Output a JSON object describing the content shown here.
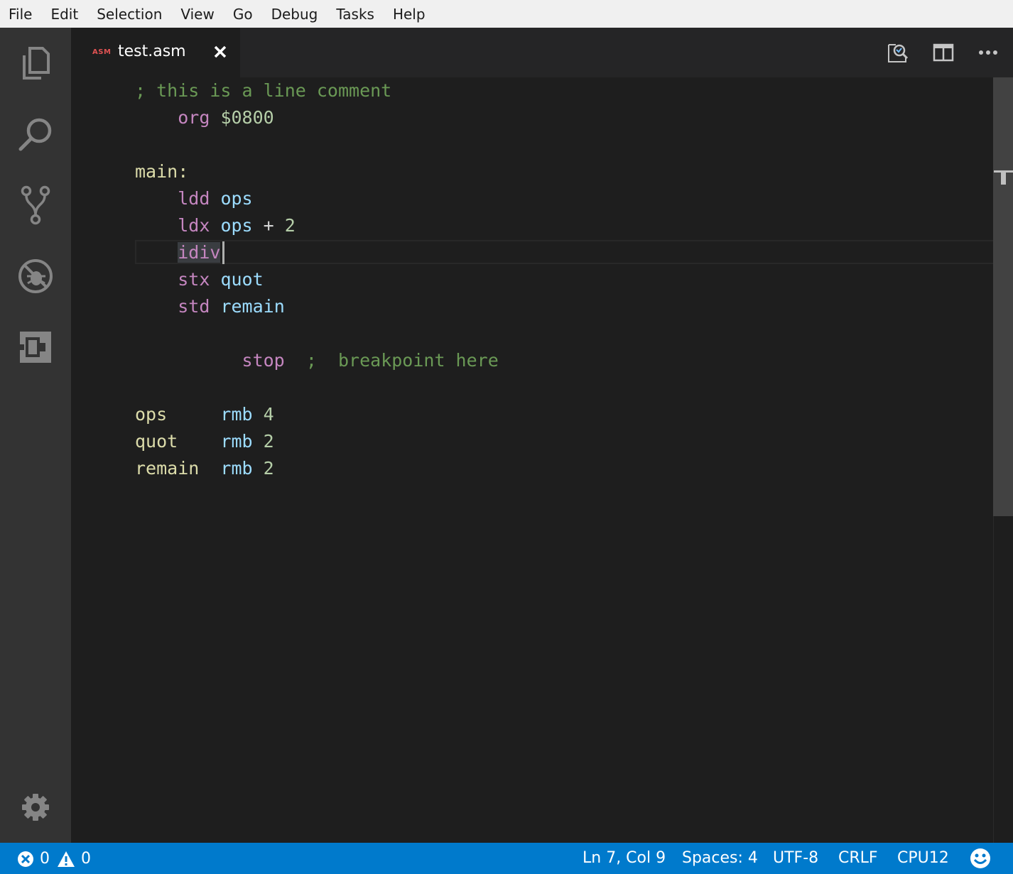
{
  "menu": [
    "File",
    "Edit",
    "Selection",
    "View",
    "Go",
    "Debug",
    "Tasks",
    "Help"
  ],
  "activity_bar": [
    {
      "icon": "files-icon"
    },
    {
      "icon": "search-icon"
    },
    {
      "icon": "source-control-icon"
    },
    {
      "icon": "debug-icon"
    },
    {
      "icon": "extensions-icon"
    },
    {
      "icon": "gear-icon"
    }
  ],
  "tab": {
    "lang_badge": "ASM",
    "title": "test.asm",
    "close": "✕"
  },
  "editor_actions": [
    "open-preview-icon",
    "split-editor-icon",
    "more-actions-icon"
  ],
  "editor": {
    "lines": [
      [
        {
          "t": "; this is a line comment",
          "c": "comment"
        }
      ],
      [
        {
          "t": "    ",
          "c": "op"
        },
        {
          "t": "org",
          "c": "kw"
        },
        {
          "t": " ",
          "c": "op"
        },
        {
          "t": "$0800",
          "c": "num"
        }
      ],
      [],
      [
        {
          "t": "main:",
          "c": "label"
        }
      ],
      [
        {
          "t": "    ",
          "c": "op"
        },
        {
          "t": "ldd",
          "c": "kw"
        },
        {
          "t": " ",
          "c": "op"
        },
        {
          "t": "ops",
          "c": "ident"
        }
      ],
      [
        {
          "t": "    ",
          "c": "op"
        },
        {
          "t": "ldx",
          "c": "kw"
        },
        {
          "t": " ",
          "c": "op"
        },
        {
          "t": "ops",
          "c": "ident"
        },
        {
          "t": " + ",
          "c": "op"
        },
        {
          "t": "2",
          "c": "num"
        }
      ],
      [
        {
          "t": "    ",
          "c": "op"
        },
        {
          "t": "idiv",
          "c": "kw",
          "sel": true
        }
      ],
      [
        {
          "t": "    ",
          "c": "op"
        },
        {
          "t": "stx",
          "c": "kw"
        },
        {
          "t": " ",
          "c": "op"
        },
        {
          "t": "quot",
          "c": "ident"
        }
      ],
      [
        {
          "t": "    ",
          "c": "op"
        },
        {
          "t": "std",
          "c": "kw"
        },
        {
          "t": " ",
          "c": "op"
        },
        {
          "t": "remain",
          "c": "ident"
        }
      ],
      [],
      [
        {
          "t": "          ",
          "c": "op"
        },
        {
          "t": "stop",
          "c": "kw"
        },
        {
          "t": "  ",
          "c": "op"
        },
        {
          "t": ";  breakpoint here",
          "c": "comment"
        }
      ],
      [],
      [
        {
          "t": "ops",
          "c": "label"
        },
        {
          "t": "     ",
          "c": "op"
        },
        {
          "t": "rmb",
          "c": "ident"
        },
        {
          "t": " ",
          "c": "op"
        },
        {
          "t": "4",
          "c": "num"
        }
      ],
      [
        {
          "t": "quot",
          "c": "label"
        },
        {
          "t": "    ",
          "c": "op"
        },
        {
          "t": "rmb",
          "c": "ident"
        },
        {
          "t": " ",
          "c": "op"
        },
        {
          "t": "2",
          "c": "num"
        }
      ],
      [
        {
          "t": "remain",
          "c": "label"
        },
        {
          "t": "  ",
          "c": "op"
        },
        {
          "t": "rmb",
          "c": "ident"
        },
        {
          "t": " ",
          "c": "op"
        },
        {
          "t": "2",
          "c": "num"
        }
      ]
    ]
  },
  "status": {
    "errors": "0",
    "warnings": "0",
    "position": "Ln 7, Col 9",
    "spaces": "Spaces: 4",
    "encoding": "UTF-8",
    "eol": "CRLF",
    "language": "CPU12"
  },
  "colors": {
    "status_bar": "#007acc",
    "comment": "#6a9955",
    "keyword": "#c586c0",
    "label": "#dcdcaa",
    "identifier": "#9cdcfe",
    "number": "#b5cea8"
  }
}
